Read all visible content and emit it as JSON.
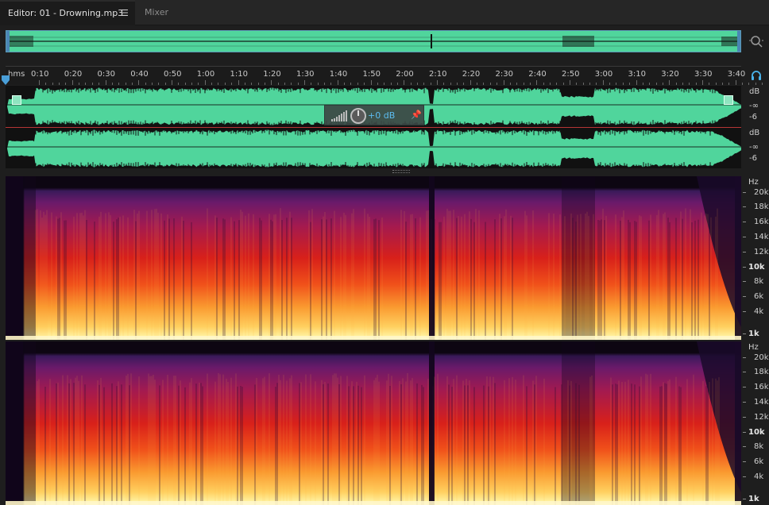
{
  "tabs": {
    "editor": "Editor: 01 - Drowning.mp3",
    "mixer": "Mixer"
  },
  "timeline": {
    "unit_label": "hms",
    "ticks": [
      "0:10",
      "0:20",
      "0:30",
      "0:40",
      "0:50",
      "1:00",
      "1:10",
      "1:20",
      "1:30",
      "1:40",
      "1:50",
      "2:00",
      "2:10",
      "2:20",
      "2:30",
      "2:40",
      "2:50",
      "3:00",
      "3:10",
      "3:20",
      "3:30",
      "3:40"
    ]
  },
  "hud": {
    "gain_value": "+0 dB"
  },
  "amplitude_scale": {
    "unit": "dB",
    "neg_inf": "-∞",
    "minus6": "-6"
  },
  "frequency_scale": {
    "unit": "Hz",
    "labels": [
      "20k",
      "18k",
      "16k",
      "14k",
      "12k",
      "10k",
      "8k",
      "6k",
      "4k",
      "1k"
    ]
  },
  "icons": {
    "tab_menu": "menu-icon",
    "zoom": "zoom-icon",
    "headphones": "headphones-icon",
    "playhead": "playhead-marker",
    "pin": "pin-icon",
    "volume_knob": "volume-knob-icon",
    "level_meter": "level-meter-icon"
  },
  "colors": {
    "waveform": "#50d59c",
    "playhead": "#4a9fd8",
    "hud_value": "#5cbcf0",
    "centerline": "#e04040"
  }
}
